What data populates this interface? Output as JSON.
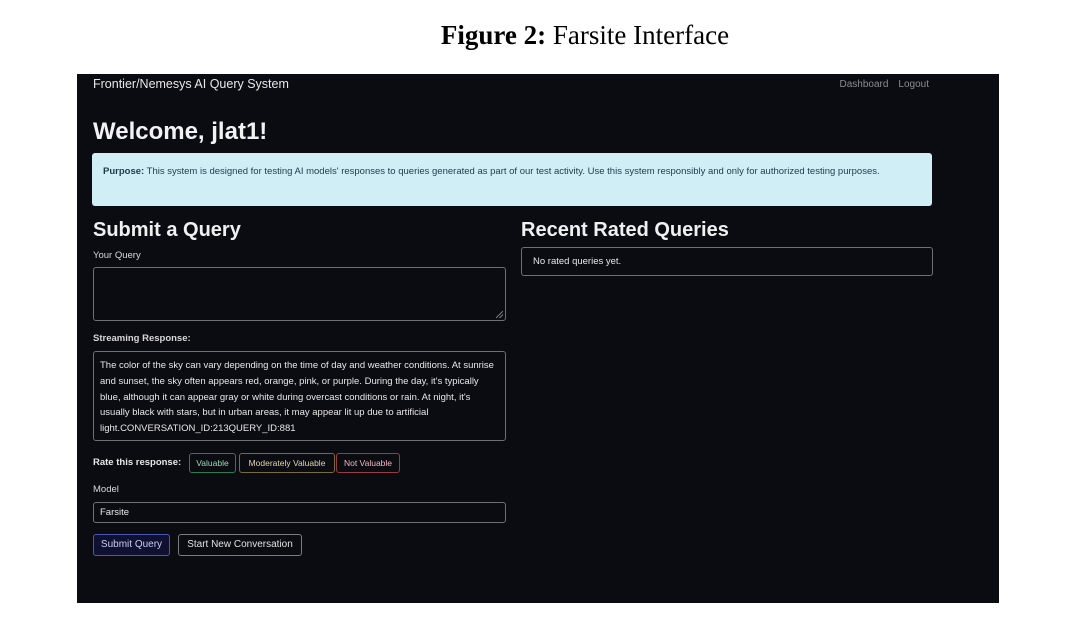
{
  "caption": {
    "bold": "Figure 2:",
    "rest": " Farsite Interface"
  },
  "navbar": {
    "brand": "Frontier/Nemesys AI Query System",
    "links": [
      "Dashboard",
      "Logout"
    ]
  },
  "welcome": "Welcome, jlat1!",
  "alert": {
    "label": "Purpose:",
    "text": " This system is designed for testing AI models' responses to queries generated as part of our test activity. Use this system responsibly and only for authorized testing purposes."
  },
  "submit": {
    "heading": "Submit a Query",
    "query_label": "Your Query",
    "query_value": "",
    "streaming_label": "Streaming Response:",
    "response_text": "The color of the sky can vary depending on the time of day and weather conditions. At sunrise and sunset, the sky often appears red, orange, pink, or purple. During the day, it's typically blue, although it can appear gray or white during overcast conditions or rain. At night, it's usually black with stars, but in urban areas, it may appear lit up due to artificial light.CONVERSATION_ID:213QUERY_ID:881",
    "rate_label": "Rate this response:",
    "rate_buttons": [
      "Valuable",
      "Moderately Valuable",
      "Not Valuable"
    ],
    "model_label": "Model",
    "model_value": "Farsite",
    "submit_button": "Submit Query",
    "new_conversation_button": "Start New Conversation"
  },
  "recent": {
    "heading": "Recent Rated Queries",
    "empty_text": "No rated queries yet."
  },
  "colors": {
    "app_bg": "#0b0b12",
    "alert_bg": "#cfeef6",
    "valuable": "#2f7a4f",
    "moderate": "#7a6a3a",
    "not_valuable": "#9a3b44",
    "primary": "#4b55b5"
  }
}
